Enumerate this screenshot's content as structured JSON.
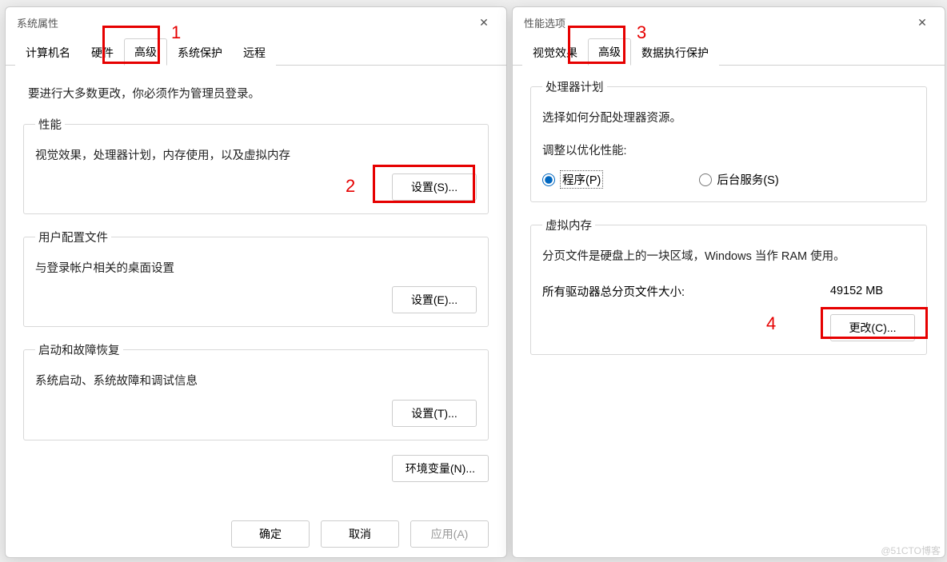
{
  "left": {
    "title": "系统属性",
    "tabs": [
      "计算机名",
      "硬件",
      "高级",
      "系统保护",
      "远程"
    ],
    "activeTab": 2,
    "note": "要进行大多数更改，你必须作为管理员登录。",
    "groups": {
      "perf": {
        "legend": "性能",
        "desc": "视觉效果，处理器计划，内存使用，以及虚拟内存",
        "btn": "设置(S)..."
      },
      "profile": {
        "legend": "用户配置文件",
        "desc": "与登录帐户相关的桌面设置",
        "btn": "设置(E)..."
      },
      "startup": {
        "legend": "启动和故障恢复",
        "desc": "系统启动、系统故障和调试信息",
        "btn": "设置(T)..."
      }
    },
    "envBtn": "环境变量(N)...",
    "footer": {
      "ok": "确定",
      "cancel": "取消",
      "apply": "应用(A)"
    }
  },
  "right": {
    "title": "性能选项",
    "tabs": [
      "视觉效果",
      "高级",
      "数据执行保护"
    ],
    "activeTab": 1,
    "cpu": {
      "legend": "处理器计划",
      "desc": "选择如何分配处理器资源。",
      "optimize": "调整以优化性能:",
      "radio1": "程序(P)",
      "radio2": "后台服务(S)"
    },
    "vm": {
      "legend": "虚拟内存",
      "desc": "分页文件是硬盘上的一块区域，Windows 当作 RAM 使用。",
      "totalLabel": "所有驱动器总分页文件大小:",
      "totalValue": "49152 MB",
      "btn": "更改(C)..."
    }
  },
  "annotations": {
    "n1": "1",
    "n2": "2",
    "n3": "3",
    "n4": "4"
  },
  "watermark": "@51CTO博客"
}
